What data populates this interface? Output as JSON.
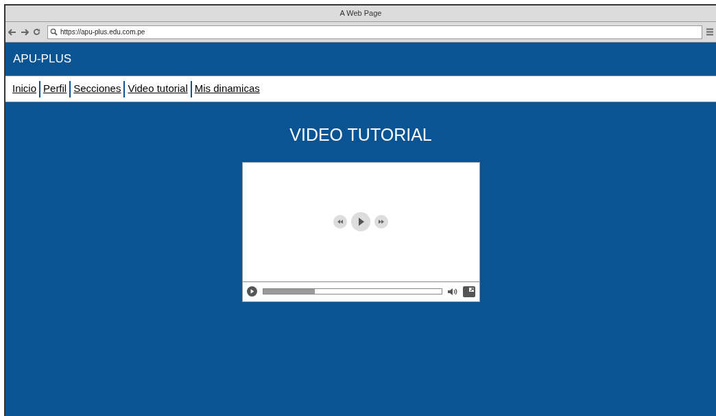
{
  "window": {
    "title": "A Web Page"
  },
  "browser": {
    "url": "https://apu-plus.edu.com.pe"
  },
  "site": {
    "title": "APU-PLUS"
  },
  "nav": [
    {
      "label": "Inicio"
    },
    {
      "label": "Perfil"
    },
    {
      "label": "Secciones"
    },
    {
      "label": "Video tutorial"
    },
    {
      "label": "Mis dinamicas"
    }
  ],
  "heading": "VIDEO TUTORIAL",
  "video": {
    "progress": {
      "level": 0.29
    }
  }
}
